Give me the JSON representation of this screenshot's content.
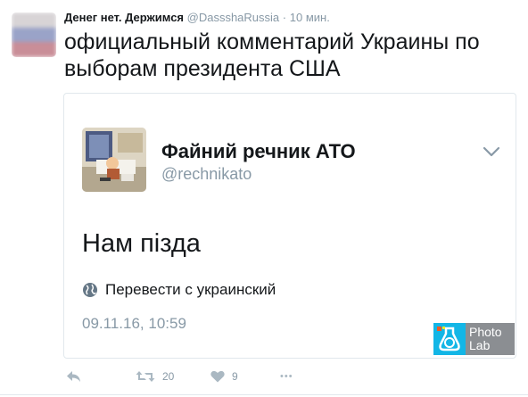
{
  "tweet": {
    "display_name": "Денег нет. Держимся",
    "handle": "@DassshaRussia",
    "separator": "·",
    "time": "10 мин.",
    "text": "официальный комментарий Украины по выборам президента США",
    "avatar_icon": "russian-flag-avatar",
    "actions": {
      "retweet_count": "20",
      "like_count": "9",
      "reply_icon": "reply-icon",
      "retweet_icon": "retweet-icon",
      "like_icon": "heart-icon",
      "more_icon": "more-icon",
      "more_label": "•••"
    }
  },
  "quoted": {
    "display_name": "Файний речник АТО",
    "handle": "@rechnikato",
    "text": "Нам пізда",
    "translate_label": "Перевести с украинский",
    "date": "09.11.16, 10:59",
    "chevron_icon": "chevron-down-icon",
    "globe_icon": "globe-icon"
  },
  "watermark": {
    "line1": "Photo",
    "line2": "Lab"
  },
  "colors": {
    "text": "#14171a",
    "secondary": "#8899a6",
    "border": "#e1e8ed",
    "photolab_blue": "#13b6e6",
    "photolab_grey": "#8b8e92"
  }
}
